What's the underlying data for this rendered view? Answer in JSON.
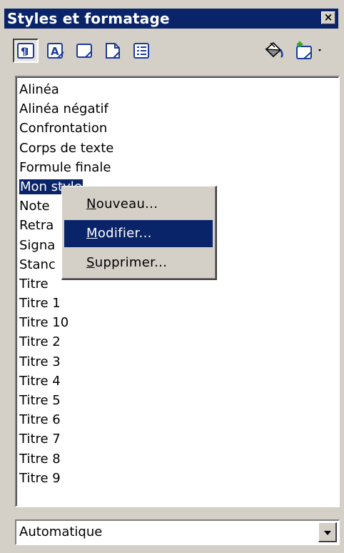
{
  "window": {
    "title": "Styles et formatage",
    "close_label": "×"
  },
  "toolbar": {
    "buttons": [
      {
        "icon": "paragraph-styles-icon",
        "pressed": true
      },
      {
        "icon": "character-styles-icon",
        "pressed": false
      },
      {
        "icon": "frame-styles-icon",
        "pressed": false
      },
      {
        "icon": "page-styles-icon",
        "pressed": false
      },
      {
        "icon": "list-styles-icon",
        "pressed": false
      },
      {
        "icon": "fill-format-mode-icon",
        "pressed": false
      },
      {
        "icon": "new-style-from-selection-icon",
        "pressed": false
      }
    ]
  },
  "styles_list": {
    "items": [
      "Alinéa",
      "Alinéa négatif",
      "Confrontation",
      "Corps de texte",
      "Formule finale",
      "Mon style",
      "Note",
      "Retra",
      "Signa",
      "Stanc",
      "Titre",
      "Titre 1",
      "Titre 10",
      "Titre 2",
      "Titre 3",
      "Titre 4",
      "Titre 5",
      "Titre 6",
      "Titre 7",
      "Titre 8",
      "Titre 9"
    ],
    "selected_index": 5
  },
  "context_menu": {
    "items": [
      {
        "accel": "N",
        "rest": "ouveau..."
      },
      {
        "accel": "M",
        "rest": "odifier..."
      },
      {
        "accel": "S",
        "rest": "upprimer..."
      }
    ],
    "highlighted_index": 1
  },
  "filter": {
    "value": "Automatique"
  },
  "colors": {
    "face": "#d4d0c8",
    "highlight": "#0a246a",
    "highlight_text": "#ffffff"
  }
}
